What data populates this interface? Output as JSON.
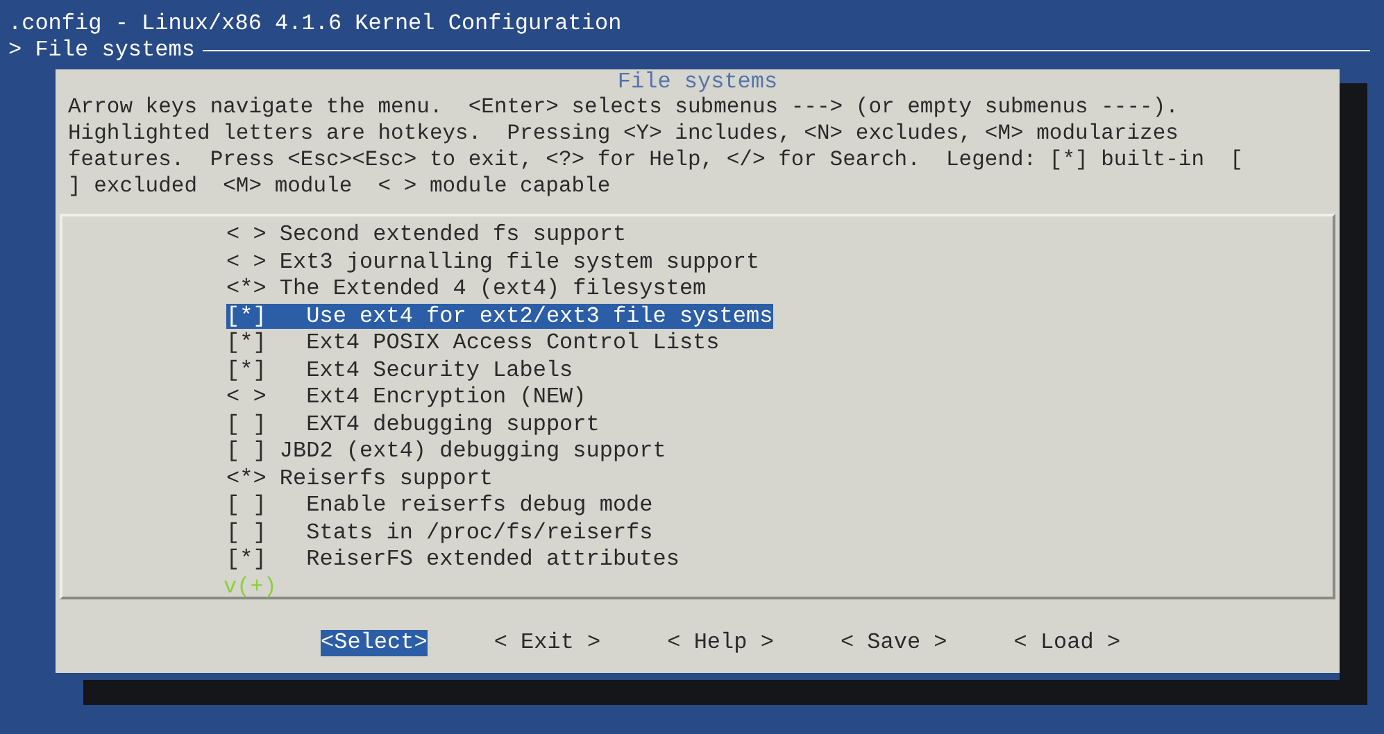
{
  "window": {
    "title": ".config - Linux/x86 4.1.6 Kernel Configuration",
    "breadcrumb": "> File systems"
  },
  "dialog": {
    "title": "File systems",
    "help": "Arrow keys navigate the menu.  <Enter> selects submenus ---> (or empty submenus ----).  Highlighted letters are hotkeys.  Pressing <Y> includes, <N> excludes, <M> modularizes features.  Press <Esc><Esc> to exit, <?> for Help, </> for Search.  Legend: [*] built-in  [ ] excluded  <M> module  < > module capable"
  },
  "menu": {
    "items": [
      {
        "marker": "< >",
        "label": "Second extended fs support",
        "selected": false
      },
      {
        "marker": "< >",
        "label": "Ext3 journalling file system support",
        "selected": false
      },
      {
        "marker": "<*>",
        "label": "The Extended 4 (ext4) filesystem",
        "selected": false,
        "children": [
          {
            "marker": "[*]",
            "label": "Use ext4 for ext2/ext3 file systems",
            "selected": true
          },
          {
            "marker": "[*]",
            "label": "Ext4 POSIX Access Control Lists",
            "selected": false
          },
          {
            "marker": "[*]",
            "label": "Ext4 Security Labels",
            "selected": false
          },
          {
            "marker": "< >",
            "label": "Ext4 Encryption (NEW)",
            "selected": false
          },
          {
            "marker": "[ ]",
            "label": "EXT4 debugging support",
            "selected": false
          }
        ]
      },
      {
        "marker": "[ ]",
        "label": "JBD2 (ext4) debugging support",
        "selected": false
      },
      {
        "marker": "<*>",
        "label": "Reiserfs support",
        "selected": false,
        "children": [
          {
            "marker": "[ ]",
            "label": "Enable reiserfs debug mode",
            "selected": false
          },
          {
            "marker": "[ ]",
            "label": "Stats in /proc/fs/reiserfs",
            "selected": false
          },
          {
            "marker": "[*]",
            "label": "ReiserFS extended attributes",
            "selected": false
          }
        ]
      }
    ],
    "scroll_indicator": "v(+)"
  },
  "buttons": [
    {
      "label": "<Select>",
      "selected": true
    },
    {
      "label": "< Exit >",
      "selected": false
    },
    {
      "label": "< Help >",
      "selected": false
    },
    {
      "label": "< Save >",
      "selected": false
    },
    {
      "label": "< Load >",
      "selected": false
    }
  ]
}
